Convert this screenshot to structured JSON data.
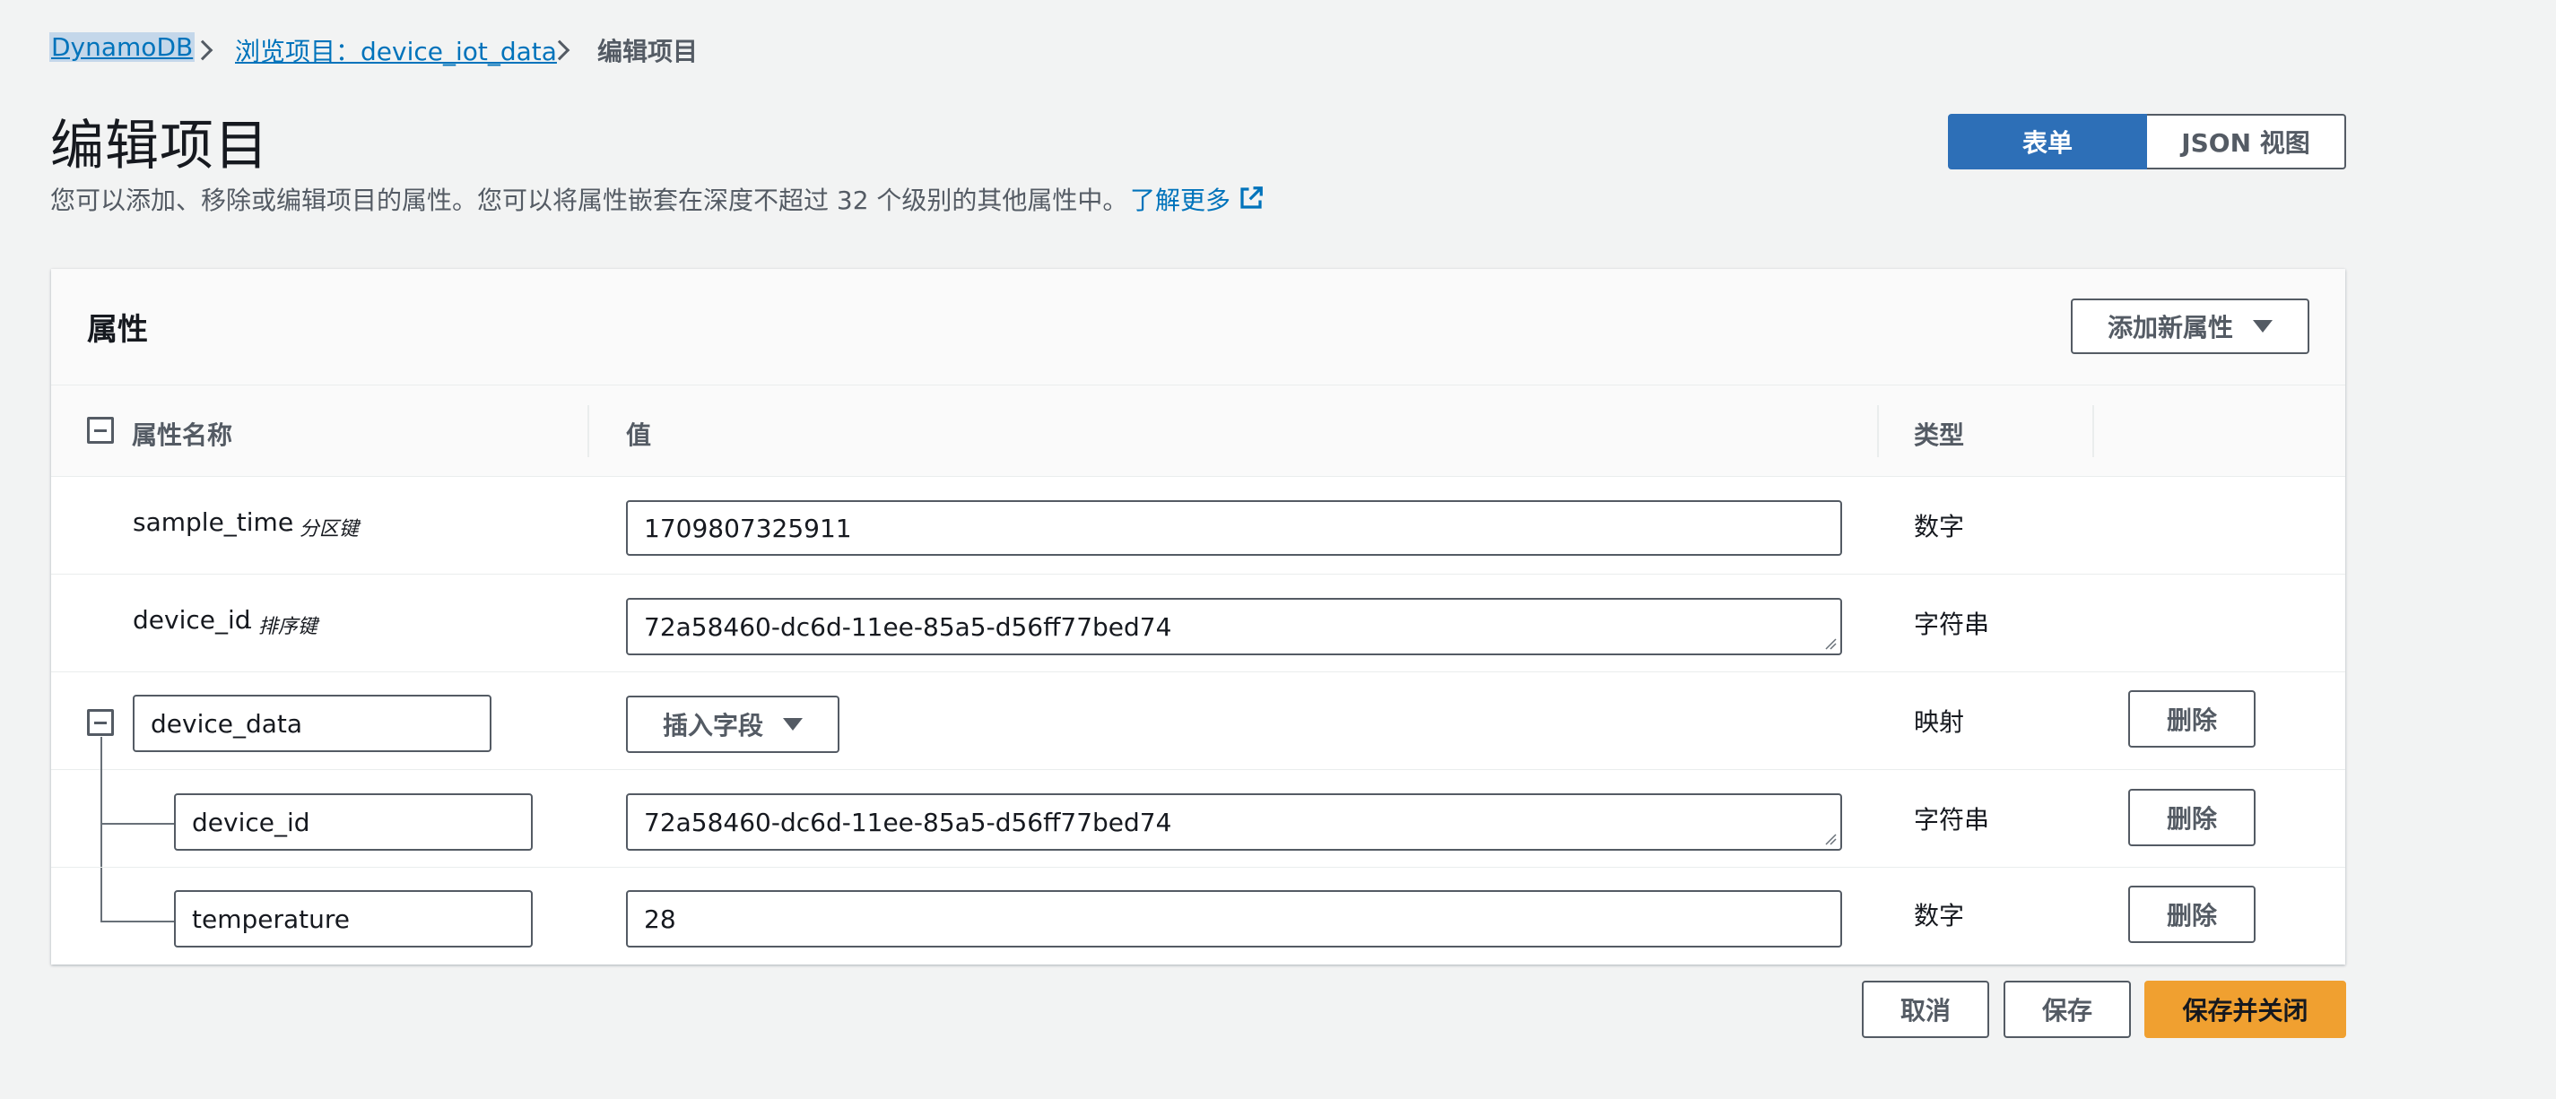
{
  "breadcrumb": {
    "items": [
      {
        "label": "DynamoDB"
      },
      {
        "label": "浏览项目：device_iot_data"
      },
      {
        "label": "编辑项目"
      }
    ]
  },
  "header": {
    "title": "编辑项目",
    "description": "您可以添加、移除或编辑项目的属性。您可以将属性嵌套在深度不超过 32 个级别的其他属性中。",
    "learn_more": "了解更多"
  },
  "view_toggle": {
    "form": "表单",
    "json": "JSON 视图",
    "selected": "表单"
  },
  "panel": {
    "title": "属性",
    "add_attribute": "添加新属性"
  },
  "table": {
    "columns": {
      "name": "属性名称",
      "value": "值",
      "type": "类型"
    },
    "rows": [
      {
        "name": "sample_time",
        "suffix": "- 分区键",
        "value": "1709807325911",
        "type": "数字"
      },
      {
        "name": "device_id",
        "suffix": "- 排序键",
        "value": "72a58460-dc6d-11ee-85a5-d56ff77bed74",
        "type": "字符串"
      },
      {
        "name": "device_data",
        "insert_field": "插入字段",
        "type": "映射",
        "delete": "删除"
      },
      {
        "name": "device_id",
        "value": "72a58460-dc6d-11ee-85a5-d56ff77bed74",
        "type": "字符串",
        "delete": "删除"
      },
      {
        "name": "temperature",
        "value": "28",
        "type": "数字",
        "delete": "删除"
      }
    ]
  },
  "footer": {
    "cancel": "取消",
    "save": "保存",
    "save_close": "保存并关闭"
  },
  "colors": {
    "link": "#0073bb",
    "toggle_active": "#2d6fb7",
    "primary_button": "#f0a030",
    "background": "#f2f3f3"
  },
  "icons": {
    "breadcrumb_separator": "chevron-right-icon",
    "learn_more": "external-link-icon",
    "collapse": "collapse-icon",
    "dropdown": "caret-down-icon"
  }
}
